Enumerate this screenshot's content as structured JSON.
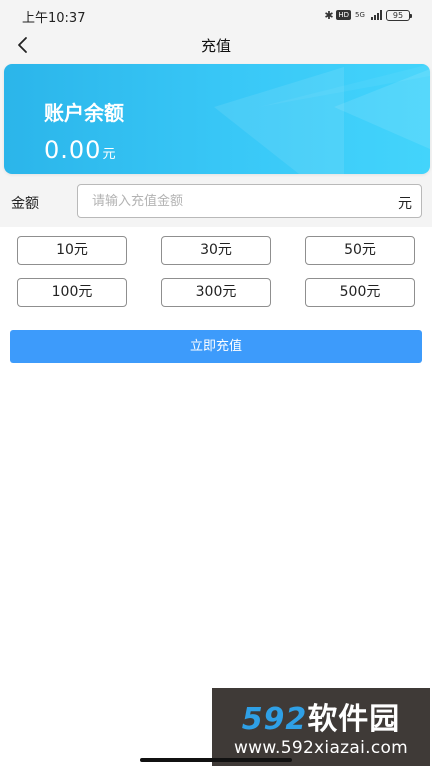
{
  "status_bar": {
    "time": "上午10:37",
    "bluetooth_icon": "bluetooth-icon",
    "hd_badge": "HD",
    "network": "5G",
    "battery": "95"
  },
  "nav": {
    "title": "充值",
    "back_icon": "chevron-left-icon"
  },
  "balance": {
    "label": "账户余额",
    "value": "0.00",
    "unit": "元"
  },
  "amount": {
    "label": "金额",
    "placeholder": "请输入充值金额",
    "value": "",
    "unit": "元"
  },
  "presets": [
    "10元",
    "30元",
    "50元",
    "100元",
    "300元",
    "500元"
  ],
  "submit_label": "立即充值",
  "watermark": {
    "number": "592",
    "text": "软件园",
    "url": "www.592xiazai.com"
  },
  "colors": {
    "accent": "#3d9bfb",
    "card_start": "#2bb5ea",
    "card_end": "#43d4fb",
    "background_grey": "#f4f4f4"
  }
}
